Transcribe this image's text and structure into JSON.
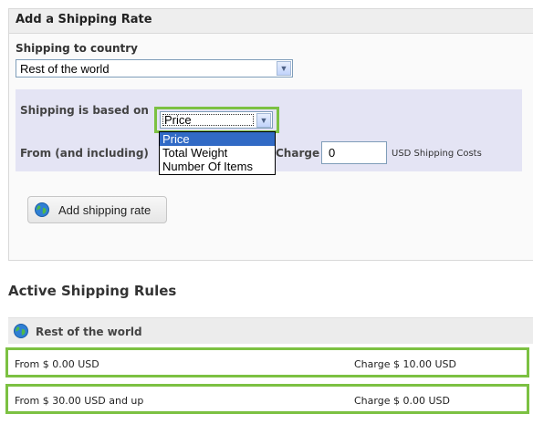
{
  "panel": {
    "title": "Add a Shipping Rate",
    "country_label": "Shipping to country",
    "country_value": "Rest of the world",
    "based_on_label": "Shipping is based on",
    "based_on_value": "Price",
    "based_on_options": [
      "Price",
      "Total Weight",
      "Number Of Items"
    ],
    "from_label": "From (and including)",
    "charge_label": "Charge",
    "charge_value": "0",
    "currency_note": "USD Shipping Costs",
    "add_button": "Add shipping rate"
  },
  "rules": {
    "title": "Active Shipping Rules",
    "group_label": "Rest of the world",
    "rows": [
      {
        "from": "From $ 0.00 USD",
        "charge": "Charge $ 10.00 USD"
      },
      {
        "from": "From $ 30.00 USD and up",
        "charge": "Charge $ 0.00 USD"
      }
    ]
  },
  "colors": {
    "highlight": "#7cc142",
    "selected_option": "#316ac5",
    "rate_box": "#e4e4f4"
  },
  "icons": [
    "globe-icon",
    "chevron-down-icon"
  ]
}
